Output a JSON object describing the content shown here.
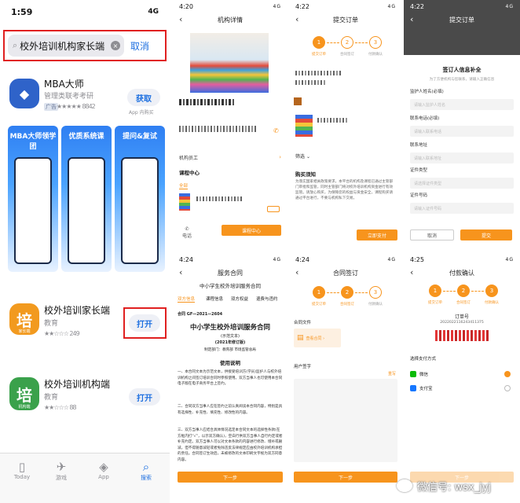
{
  "p1": {
    "time": "1:59",
    "signal": "4G",
    "search_value": "校外培训机构家长端",
    "cancel": "取消",
    "apps": [
      {
        "name": "MBA大师",
        "subtitle": "管理类联考考研",
        "ad": "广告",
        "rating": "8842",
        "btn": "获取",
        "note": "App 内购买"
      },
      {
        "name": "校外培训家长端",
        "subtitle": "教育",
        "rating": "249",
        "btn": "打开",
        "icon_char": "培",
        "icon_tag": "家长端"
      },
      {
        "name": "校外培训机构端",
        "subtitle": "教育",
        "rating": "88",
        "btn": "打开",
        "icon_char": "培",
        "icon_tag": "机构端"
      }
    ],
    "shots": [
      "MBA大师领学团",
      "优质系统课",
      "提问&复试"
    ],
    "tabs": [
      "Today",
      "游戏",
      "App",
      "搜索"
    ]
  },
  "p2": {
    "time": "4:20",
    "signal": "4G",
    "title": "机构详情",
    "org_members": "机构员工",
    "course_center": "课程中心",
    "all": "全部",
    "phone": "电话",
    "course_btn": "课程中心"
  },
  "p3": {
    "time": "4:22",
    "signal": "4G",
    "title": "提交订单",
    "steps": [
      "1",
      "2",
      "3"
    ],
    "step_labels": [
      "提交订单",
      "合同签订",
      "付款确认"
    ],
    "filter": "筛选",
    "notice_title": "购买须知",
    "notice_text": "为落实国家相关政策要求，本平台的机构及课程已通过主管部门审批和监管，同时主管部门将对校外培训机构资金进行有效监管。请放心购买，为保障您的权益与资金安全，课程购买请通过平台进行，不要与机构私下交易。",
    "submit": "立即支付"
  },
  "p4": {
    "time": "4:22",
    "signal": "4G",
    "title": "提交订单",
    "sheet_title": "签订人信息补全",
    "sheet_sub": "为了方便机构与您联系，请输入正确信息",
    "fields": [
      {
        "label": "监护人姓名(必填)",
        "ph": "请输入监护人姓名"
      },
      {
        "label": "联系电话(必填)",
        "ph": "请输入联系电话"
      },
      {
        "label": "联系地址",
        "ph": "请输入联系地址"
      },
      {
        "label": "证件类型",
        "ph": "请选择证件类型"
      },
      {
        "label": "证件号码",
        "ph": "请输入证件号码"
      }
    ],
    "cancel": "取消",
    "submit": "提交"
  },
  "p5": {
    "time": "4:24",
    "signal": "4G",
    "title": "服务合同",
    "header": "中小学生校外培训服务合同",
    "tabs": [
      "双方信息",
      "课程信息",
      "双方权益",
      "退费与违约"
    ],
    "number": "合同 GF—2021—2604",
    "big_title": "中小学生校外培训服务合同",
    "edition1": "(示范文本)",
    "edition2": "(2021年修订版)",
    "makers": "制定部门：教育部 市场监管总局",
    "usage": "使用说明",
    "paras": [
      "一、本合同文本为示范文本，供接受培训方(学员)监护人与校外培训机构之间签订培训合同时参照使用。双方当事人也可使用本合同电子版在电子商务平台上签约。",
      "二、合同双方当事人应在签约之前认真阅读本合同内容，特别是具有选择性、补充性、填充性、修改性的内容。",
      "三、双方当事人应结合具体情况选定本合同文本的选择性条款(在方框内打“√”，以示双方确认)，空白行供双方当事人自行约定或者补充约定。双方当事人可以对文本条款的内容进行修改、增补或删减，但不得随意减轻或者免除违反法律规定应由校外培训机构承担的责任。合同签订生效后，未被修改的文本印刷文字视为双方同意内容。"
    ],
    "next": "下一步"
  },
  "p6": {
    "time": "4:24",
    "signal": "4G",
    "title": "合同签订",
    "steps": [
      "1",
      "2",
      "3"
    ],
    "step_labels": [
      "提交订单",
      "合同签订",
      "付款确认"
    ],
    "contract_file": "合同文件",
    "view_contract": "查看合同 ›",
    "user_sign": "用户签字",
    "clear": "重写",
    "next": "下一步"
  },
  "p7": {
    "time": "4:25",
    "signal": "4G",
    "title": "付款确认",
    "steps": [
      "1",
      "2",
      "3"
    ],
    "step_labels": [
      "提交订单",
      "合同签订",
      "付款确认"
    ],
    "order_label": "订单号",
    "order_no": "2022022116243411375",
    "pay_method": "选择支付方式",
    "methods": [
      "微信",
      "支付宝"
    ],
    "next": "下一步"
  },
  "watermark": "微信号: wsx_jyj",
  "colors": {
    "orange": "#f7941d",
    "ios_blue": "#1d6fe0",
    "highlight_red": "#e02020",
    "wechat_green": "#09bb07",
    "alipay_blue": "#1677ff"
  }
}
